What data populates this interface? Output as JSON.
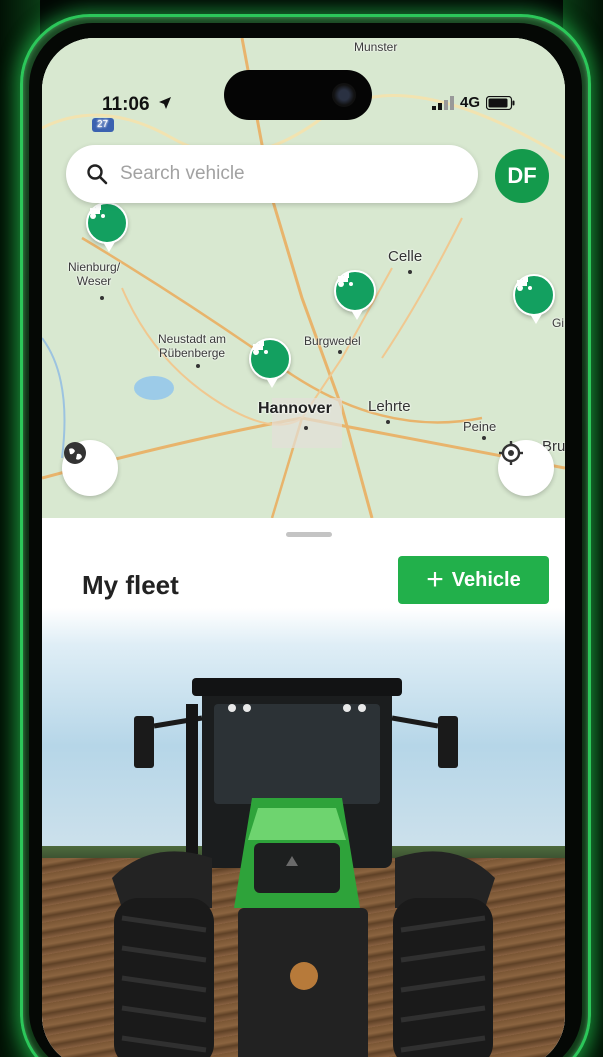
{
  "status_bar": {
    "time": "11:06",
    "network": "4G"
  },
  "search": {
    "placeholder": "Search vehicle"
  },
  "user": {
    "initials": "DF"
  },
  "map": {
    "labels": {
      "munster": "Munster",
      "road_27": "27",
      "nienburg": "Nienburg/\nWeser",
      "celle": "Celle",
      "neustadt": "Neustadt am\nRübenberge",
      "burgwedel": "Burgwedel",
      "hannover": "Hannover",
      "lehrte": "Lehrte",
      "peine": "Peine",
      "bru": "Bru",
      "gi": "Gi"
    }
  },
  "fleet": {
    "title": "My fleet",
    "add_label": "Vehicle"
  },
  "colors": {
    "brand_green": "#22b04b",
    "pin_green": "#13a060",
    "avatar_green": "#149a4c"
  }
}
